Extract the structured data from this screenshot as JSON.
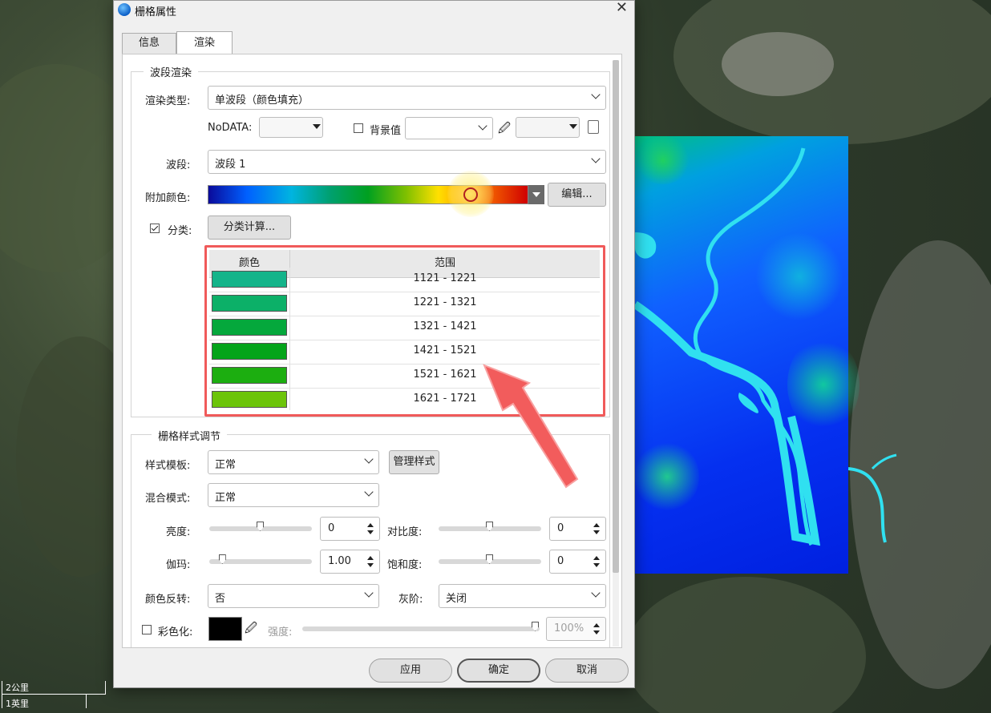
{
  "dialog": {
    "title": "栅格属性",
    "tabs": [
      {
        "label": "信息",
        "active": false
      },
      {
        "label": "渲染",
        "active": true
      }
    ]
  },
  "band_render": {
    "group_title": "波段渲染",
    "render_type_label": "渲染类型:",
    "render_type_value": "单波段（颜色填充）",
    "nodata_label": "NoDATA:",
    "background_label": "背景值",
    "background_checked": false,
    "band_label": "波段:",
    "band_value": "波段 1",
    "color_ramp_label": "附加颜色:",
    "edit_button": "编辑...",
    "classify_label": "分类:",
    "classify_checked": true,
    "classify_button": "分类计算..."
  },
  "class_table": {
    "headers": [
      "颜色",
      "范围"
    ],
    "rows": [
      {
        "color": "#14b48a",
        "range": "1121 - 1221"
      },
      {
        "color": "#0cb068",
        "range": "1221 - 1321"
      },
      {
        "color": "#05a83c",
        "range": "1321 - 1421"
      },
      {
        "color": "#04a41a",
        "range": "1421 - 1521"
      },
      {
        "color": "#1cae10",
        "range": "1521 - 1621"
      },
      {
        "color": "#6cc40a",
        "range": "1621 - 1721"
      }
    ]
  },
  "style_adjust": {
    "group_title": "栅格样式调节",
    "template_label": "样式模板:",
    "template_value": "正常",
    "manage_button": "管理样式",
    "blend_label": "混合模式:",
    "blend_value": "正常",
    "brightness_label": "亮度:",
    "brightness_value": "0",
    "brightness_level": 0.5,
    "contrast_label": "对比度:",
    "contrast_value": "0",
    "contrast_level": 0.5,
    "gamma_label": "伽玛:",
    "gamma_value": "1.00",
    "gamma_level": 0.1,
    "saturation_label": "饱和度:",
    "saturation_value": "0",
    "saturation_level": 0.5,
    "invert_label": "颜色反转:",
    "invert_value": "否",
    "grayscale_label": "灰阶:",
    "grayscale_value": "关闭",
    "colorize_label": "彩色化:",
    "colorize_checked": false,
    "colorize_color": "#000000",
    "intensity_label": "强度:",
    "intensity_value": "100%",
    "intensity_level": 1.0
  },
  "footer": {
    "apply": "应用",
    "ok": "确定",
    "cancel": "取消"
  },
  "scale_bar": {
    "metric": "2公里",
    "imperial": "1英里"
  },
  "colors": {
    "highlight": "#f05a5a",
    "arrow": "#f25c5c"
  }
}
